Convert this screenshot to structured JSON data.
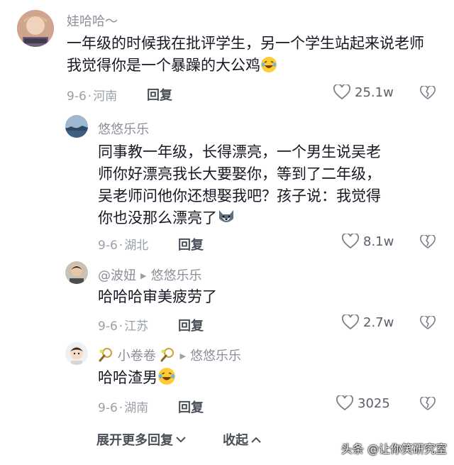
{
  "comments": [
    {
      "user": "娃哈哈～",
      "text": "一年级的时候我在批评学生，另一个学生站起来说老师我觉得你是一个暴躁的大公鸡",
      "emoji": "laughing-crying-emoji",
      "date": "9-6",
      "location": "河南",
      "reply_label": "回复",
      "likes": "25.1w"
    },
    {
      "user": "悠悠乐乐",
      "text": "同事教一年级，长得漂亮，一个男生说吴老师你好漂亮我长大要娶你，等到了二年级，吴老师问他你还想娶我吧？孩子说：我觉得你也没那么漂亮了",
      "emoji": "husky-dog-emoji",
      "date": "9-6",
      "location": "湖北",
      "reply_label": "回复",
      "likes": "8.1w"
    },
    {
      "user": "@波妞",
      "reply_to": "悠悠乐乐",
      "text": "哈哈哈审美疲劳了",
      "date": "9-6",
      "location": "江苏",
      "reply_label": "回复",
      "likes": "2.7w"
    },
    {
      "user": "小卷卷",
      "reply_to": "悠悠乐乐",
      "text": "哈哈渣男",
      "emoji": "laughing-crying-emoji",
      "date": "9-6",
      "location": "湖南",
      "reply_label": "回复",
      "likes": "3025"
    }
  ],
  "footer": {
    "expand_label": "展开更多回复",
    "collapse_label": "收起"
  },
  "watermark": "头条 @让你笑研究室",
  "colors": {
    "meta": "#9aa0a8",
    "name": "#8a8f99",
    "text": "#161823"
  }
}
